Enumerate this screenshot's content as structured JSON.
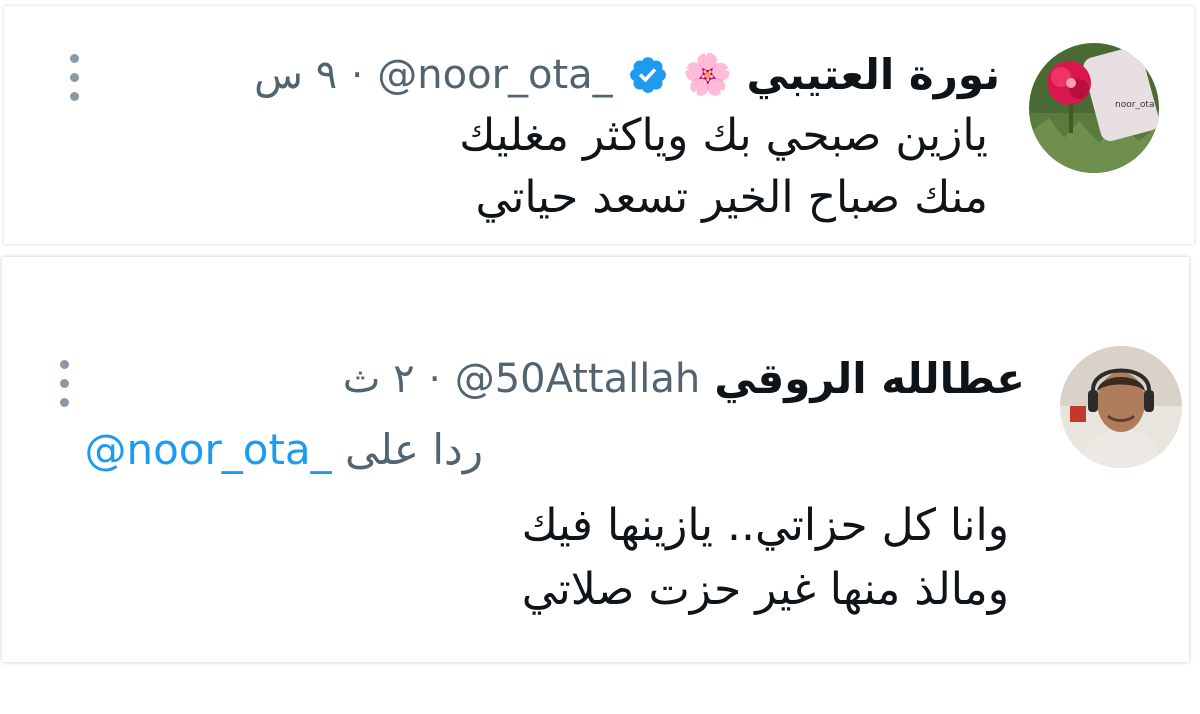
{
  "tweets": [
    {
      "author_name": "نورة العتيبي",
      "name_emoji": "🌸",
      "verified": true,
      "handle": "@noor_ota_",
      "separator": "·",
      "time": "٩ س",
      "text_line1": "يازين صبحي بك وياكثر مغليك",
      "text_line2": "منك صباح الخير تسعد حياتي"
    },
    {
      "author_name": "عطالله الروقي",
      "handle": "@50Attallah",
      "separator": "·",
      "time": "٢ ث",
      "replying_prefix": "ردا على",
      "replying_to": "@noor_ota_",
      "text_line1": "وانا كل حزاتي.. يازينها فيك",
      "text_line2": "ومالذ منها غير حزت صلاتي"
    }
  ],
  "colors": {
    "text": "#0f1419",
    "secondary": "#536471",
    "link": "#1d9bf0",
    "verified_badge": "#1d9bf0"
  },
  "icons": [
    "verified-badge-icon",
    "more-options-icon",
    "cherry-blossom-emoji"
  ]
}
